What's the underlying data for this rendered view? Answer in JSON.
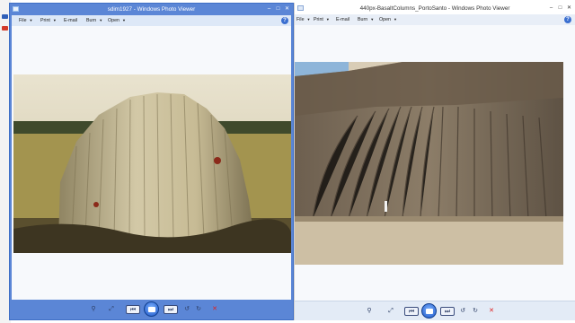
{
  "windows": [
    {
      "title": "sdim1927 - Windows Photo Viewer",
      "menu": [
        "File",
        "Print",
        "E-mail",
        "Burn",
        "Open"
      ],
      "toolbar_icons": [
        "zoom-icon",
        "fit-icon",
        "previous-icon",
        "slideshow-icon",
        "next-icon",
        "rotate-ccw-icon",
        "rotate-cw-icon",
        "delete-icon"
      ]
    },
    {
      "title": "440px-BasaltColumns_PortoSanto - Windows Photo Viewer",
      "menu": [
        "File",
        "Print",
        "E-mail",
        "Burn",
        "Open"
      ],
      "toolbar_icons": [
        "zoom-icon",
        "fit-icon",
        "previous-icon",
        "slideshow-icon",
        "next-icon",
        "rotate-ccw-icon",
        "rotate-cw-icon",
        "delete-icon"
      ]
    }
  ],
  "controls": {
    "minimize": "–",
    "maximize": "□",
    "close": "✕",
    "help": "?"
  },
  "glyphs": {
    "zoom": "⚲",
    "fit": "⤢",
    "prev": "⏮",
    "next": "⏭",
    "rotate_ccw": "↺",
    "rotate_cw": "↻",
    "delete": "✕"
  },
  "colors": {
    "accent": "#5b86d6",
    "delete": "#e02020"
  }
}
